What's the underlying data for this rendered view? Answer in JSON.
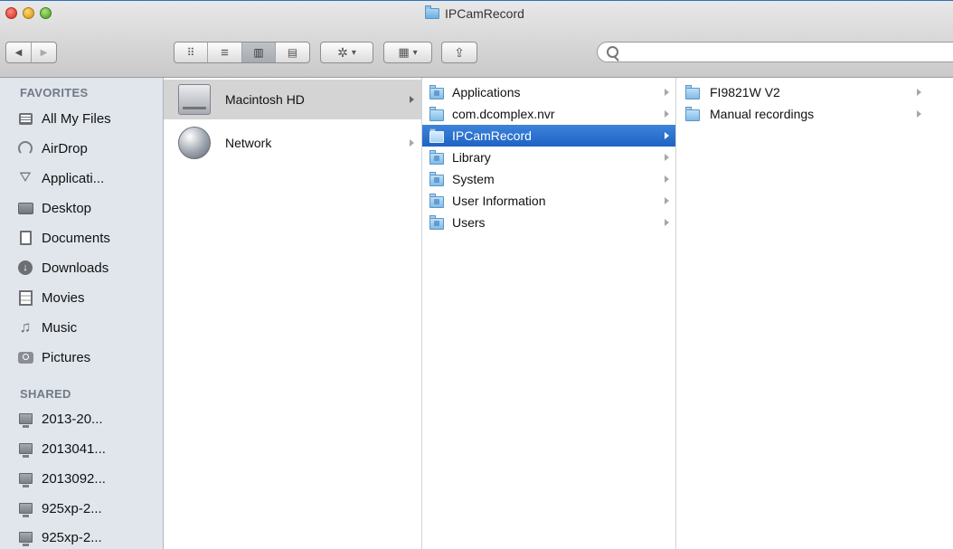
{
  "window": {
    "title": "IPCamRecord"
  },
  "toolbar": {
    "back_glyph": "◀",
    "forward_glyph": "▶",
    "view_icon_glyph": "⠿",
    "view_list_glyph": "≡",
    "view_column_glyph": "▥",
    "view_coverflow_glyph": "▤",
    "action_glyph": "✲",
    "arrange_glyph": "▦",
    "share_glyph": "⇪",
    "dropdown_glyph": "▾",
    "search": {
      "value": "",
      "placeholder": ""
    }
  },
  "sidebar": {
    "favorites_heading": "FAVORITES",
    "shared_heading": "SHARED",
    "favorites": [
      {
        "label": "All My Files",
        "icon": "all-files-icon"
      },
      {
        "label": "AirDrop",
        "icon": "airdrop-icon"
      },
      {
        "label": "Applicati...",
        "icon": "applications-icon"
      },
      {
        "label": "Desktop",
        "icon": "desktop-icon"
      },
      {
        "label": "Documents",
        "icon": "documents-icon"
      },
      {
        "label": "Downloads",
        "icon": "downloads-icon"
      },
      {
        "label": "Movies",
        "icon": "movies-icon"
      },
      {
        "label": "Music",
        "icon": "music-icon"
      },
      {
        "label": "Pictures",
        "icon": "pictures-icon"
      }
    ],
    "shared": [
      {
        "label": "2013-20...",
        "icon": "computer-icon"
      },
      {
        "label": "2013041...",
        "icon": "computer-icon"
      },
      {
        "label": "2013092...",
        "icon": "computer-icon"
      },
      {
        "label": "925xp-2...",
        "icon": "computer-icon"
      },
      {
        "label": "925xp-2...",
        "icon": "computer-icon"
      }
    ]
  },
  "columns": {
    "col1": [
      {
        "label": "Macintosh HD",
        "icon": "hard-drive-icon",
        "selected": true
      },
      {
        "label": "Network",
        "icon": "network-icon",
        "selected": false
      }
    ],
    "col2": [
      {
        "label": "Applications",
        "icon": "applications-folder-icon",
        "selected": false
      },
      {
        "label": "com.dcomplex.nvr",
        "icon": "folder-icon",
        "selected": false
      },
      {
        "label": "IPCamRecord",
        "icon": "folder-icon",
        "selected": true
      },
      {
        "label": "Library",
        "icon": "library-folder-icon",
        "selected": false
      },
      {
        "label": "System",
        "icon": "system-folder-icon",
        "selected": false
      },
      {
        "label": "User Information",
        "icon": "user-info-icon",
        "selected": false
      },
      {
        "label": "Users",
        "icon": "users-folder-icon",
        "selected": false
      }
    ],
    "col3": [
      {
        "label": "FI9821W V2",
        "icon": "folder-icon",
        "selected": false
      },
      {
        "label": "Manual recordings",
        "icon": "folder-icon",
        "selected": false
      }
    ]
  },
  "colors": {
    "selection_blue": "#2a6fd1",
    "sidebar_bg": "#e1e6ed",
    "selection_grey": "#d4d4d4"
  }
}
